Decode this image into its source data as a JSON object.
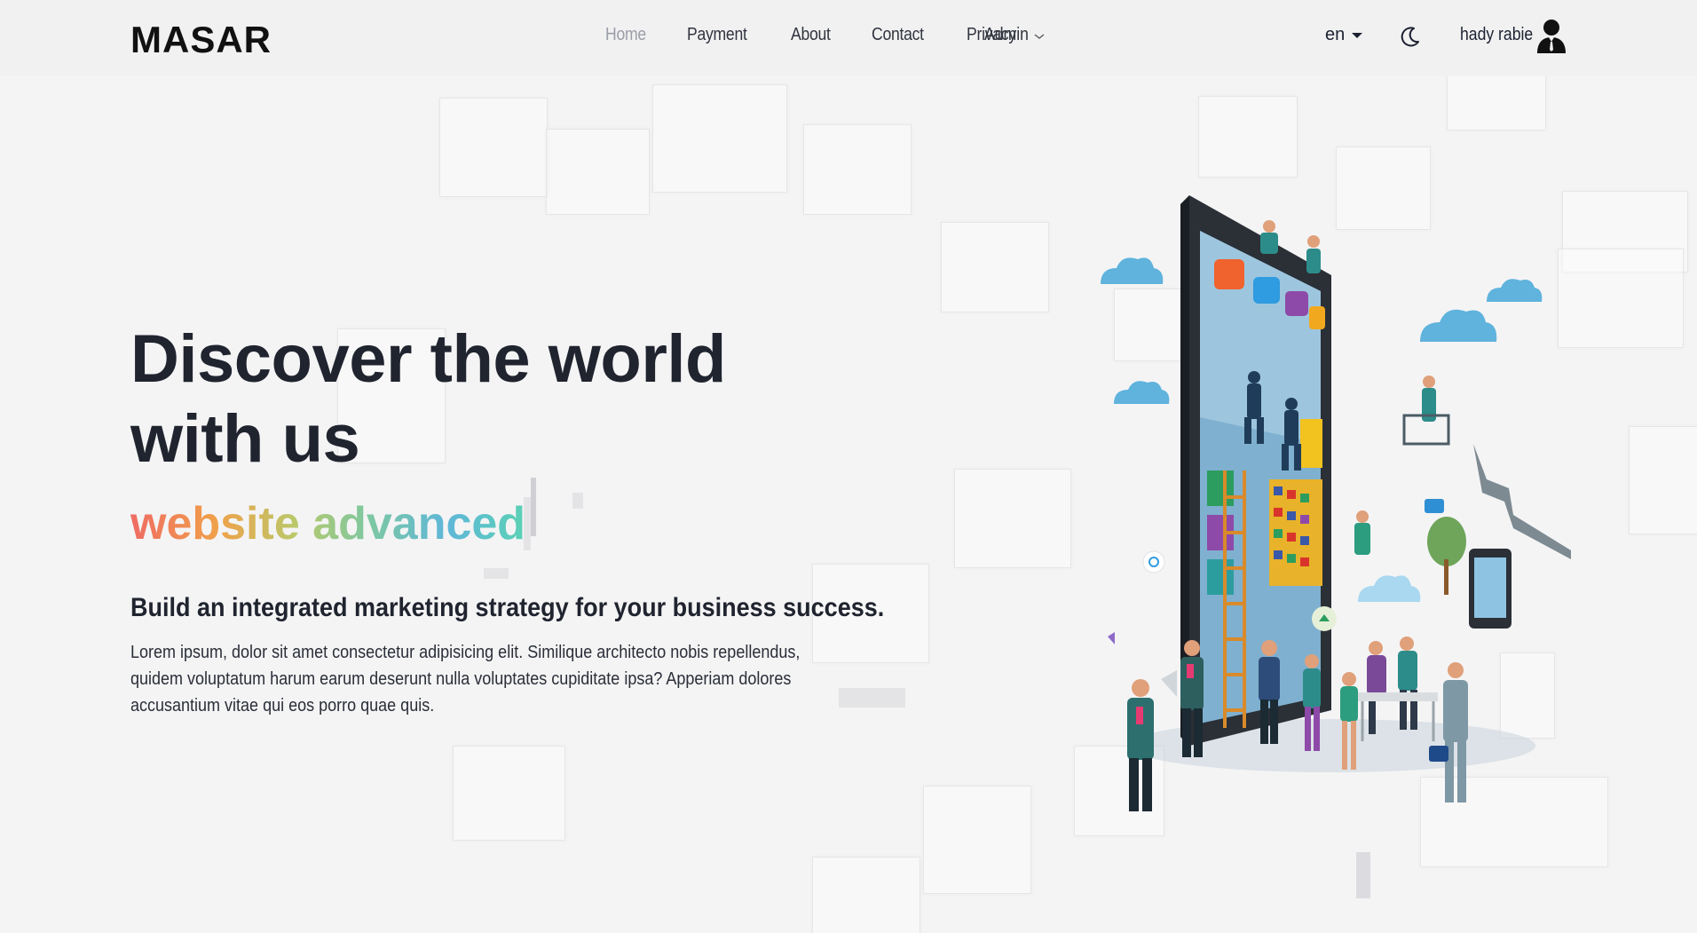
{
  "brand": {
    "logo_text": "MASAR"
  },
  "nav": {
    "links": [
      {
        "label": "Home",
        "active": true
      },
      {
        "label": "Payment",
        "active": false
      },
      {
        "label": "About",
        "active": false
      },
      {
        "label": "Contact",
        "active": false
      },
      {
        "label": "Privacy",
        "active": false
      }
    ],
    "admin_label": "Admin",
    "language": "en",
    "user_name": "hady rabie"
  },
  "hero": {
    "title_line1": "Discover the world",
    "title_line2": "with us",
    "typed_text": "website advanced",
    "subheading": "Build an integrated marketing strategy for your business success.",
    "body": "Lorem ipsum, dolor sit amet consectetur adipisicing elit. Similique architecto nobis repellendus, quidem voluptatum harum earum deserunt nulla voluptates cupiditate ipsa? Apperiam dolores accusantium vitae qui eos porro quae quis."
  },
  "icons": {
    "theme_toggle": "moon-icon",
    "user": "user-avatar-icon",
    "dropdown": "chevron-down-icon"
  },
  "colors": {
    "background": "#f4f4f5",
    "text_dark": "#20242f",
    "nav_active": "#9a9ea6",
    "gradient": [
      "#ef6b63",
      "#f0a14a",
      "#b9c96a",
      "#7ec8a0",
      "#5fb7d8",
      "#5bd1b5"
    ]
  }
}
